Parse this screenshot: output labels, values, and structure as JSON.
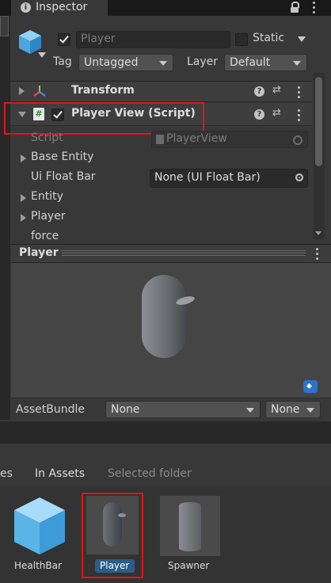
{
  "tab": {
    "title": "Inspector"
  },
  "header": {
    "name_value": "Player",
    "static_label": "Static",
    "tag_label": "Tag",
    "tag_value": "Untagged",
    "layer_label": "Layer",
    "layer_value": "Default"
  },
  "components": {
    "transform_label": "Transform",
    "script_component_label": "Player View (Script)"
  },
  "fields": {
    "script_label": "Script",
    "script_value": "PlayerView",
    "base_entity_label": "Base Entity",
    "ui_float_bar_label": "Ui Float Bar",
    "ui_float_bar_value": "None (UI Float Bar)",
    "entity_label": "Entity",
    "player_label": "Player",
    "force_label": "force"
  },
  "preview": {
    "title": "Player"
  },
  "assetbundle": {
    "label": "AssetBundle",
    "name_value": "None",
    "variant_value": "None"
  },
  "project": {
    "tabs": [
      "es",
      "In Assets",
      "Selected folder"
    ],
    "assets": [
      {
        "name": "HealthBar"
      },
      {
        "name": "Player"
      },
      {
        "name": "Spawner"
      }
    ]
  },
  "colors": {
    "highlight_red": "#e0151b",
    "selection_blue": "#2c5d87",
    "cube_blue": "#5ab4e6"
  },
  "icons": [
    "info-icon",
    "lock-icon",
    "kebab-menu-icon",
    "gameobject-cube-icon",
    "transform-axes-icon",
    "script-hash-icon",
    "help-icon",
    "presets-icon",
    "object-picker-icon",
    "asset-label-icon"
  ]
}
